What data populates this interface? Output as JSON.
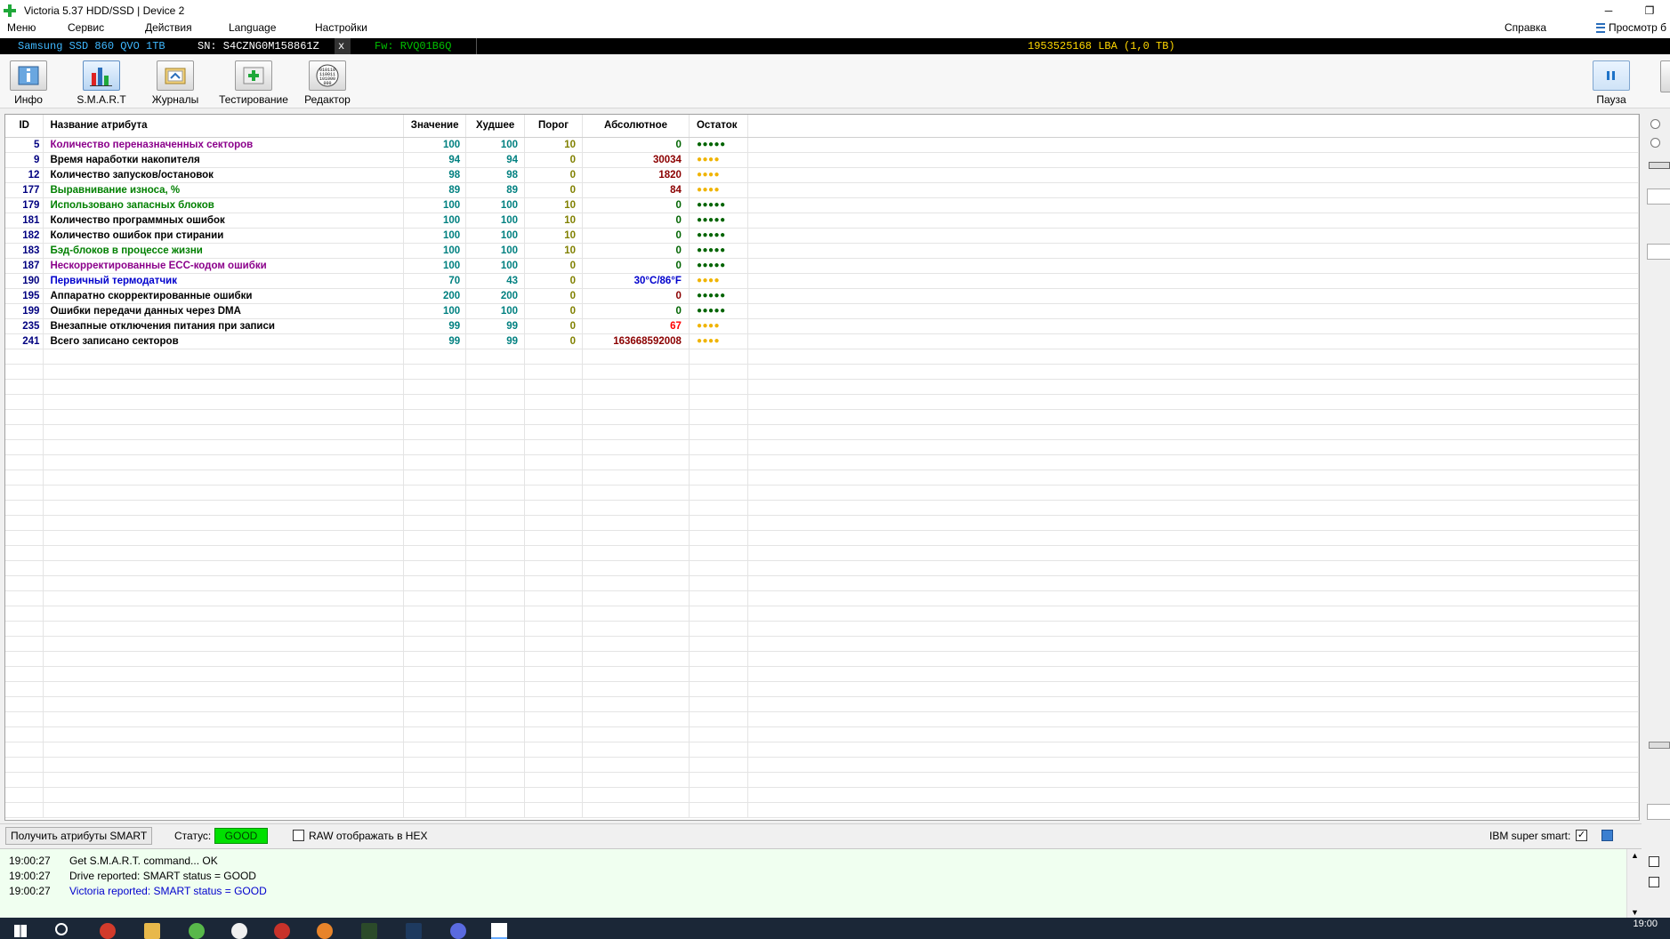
{
  "window": {
    "title": "Victoria 5.37 HDD/SSD | Device 2",
    "minimize_glyph": "─",
    "restore_glyph": "❐"
  },
  "menu": {
    "items": [
      "Меню",
      "Сервис",
      "Действия",
      "Language",
      "Настройки"
    ],
    "help": "Справка",
    "view": "Просмотр б"
  },
  "device": {
    "model": "Samsung SSD 860 QVO 1TB",
    "serial": "SN: S4CZNG0M158861Z",
    "close_glyph": "x",
    "firmware": "Fw: RVQ01B6Q",
    "capacity": "1953525168 LBA (1,0 TB)"
  },
  "toolbar": {
    "buttons": [
      {
        "label": "Инфо",
        "icon": "info-icon"
      },
      {
        "label": "S.M.A.R.T",
        "icon": "smart-chart-icon"
      },
      {
        "label": "Журналы",
        "icon": "logs-icon"
      },
      {
        "label": "Тестирование",
        "icon": "testing-icon"
      },
      {
        "label": "Редактор",
        "icon": "hex-editor-icon"
      }
    ],
    "pause_label": "Пауза"
  },
  "smart_table": {
    "headers": {
      "id": "ID",
      "name": "Название атрибута",
      "value": "Значение",
      "worst": "Худшее",
      "threshold": "Порог",
      "raw": "Абсолютное",
      "remaining": "Остаток"
    },
    "rows": [
      {
        "id": "5",
        "name": "Количество переназначенных секторов",
        "value": "100",
        "worst": "100",
        "threshold": "10",
        "raw": "0",
        "remaining": "●●●●●",
        "name_color": "#8b008b",
        "raw_color": "#006400",
        "rem_color": "#006400"
      },
      {
        "id": "9",
        "name": "Время наработки накопителя",
        "value": "94",
        "worst": "94",
        "threshold": "0",
        "raw": "30034",
        "remaining": "●●●●",
        "name_color": "#000000",
        "raw_color": "#8b0000",
        "rem_color": "#f0b400"
      },
      {
        "id": "12",
        "name": "Количество запусков/остановок",
        "value": "98",
        "worst": "98",
        "threshold": "0",
        "raw": "1820",
        "remaining": "●●●●",
        "name_color": "#000000",
        "raw_color": "#8b0000",
        "rem_color": "#f0b400"
      },
      {
        "id": "177",
        "name": "Выравнивание износа, %",
        "value": "89",
        "worst": "89",
        "threshold": "0",
        "raw": "84",
        "remaining": "●●●●",
        "name_color": "#008000",
        "raw_color": "#8b0000",
        "rem_color": "#f0b400"
      },
      {
        "id": "179",
        "name": "Использовано запасных блоков",
        "value": "100",
        "worst": "100",
        "threshold": "10",
        "raw": "0",
        "remaining": "●●●●●",
        "name_color": "#008000",
        "raw_color": "#006400",
        "rem_color": "#006400"
      },
      {
        "id": "181",
        "name": "Количество программных ошибок",
        "value": "100",
        "worst": "100",
        "threshold": "10",
        "raw": "0",
        "remaining": "●●●●●",
        "name_color": "#000000",
        "raw_color": "#006400",
        "rem_color": "#006400"
      },
      {
        "id": "182",
        "name": "Количество ошибок при стирании",
        "value": "100",
        "worst": "100",
        "threshold": "10",
        "raw": "0",
        "remaining": "●●●●●",
        "name_color": "#000000",
        "raw_color": "#006400",
        "rem_color": "#006400"
      },
      {
        "id": "183",
        "name": "Бэд-блоков в процессе жизни",
        "value": "100",
        "worst": "100",
        "threshold": "10",
        "raw": "0",
        "remaining": "●●●●●",
        "name_color": "#008000",
        "raw_color": "#006400",
        "rem_color": "#006400"
      },
      {
        "id": "187",
        "name": "Нескорректированные ECC-кодом ошибки",
        "value": "100",
        "worst": "100",
        "threshold": "0",
        "raw": "0",
        "remaining": "●●●●●",
        "name_color": "#8b008b",
        "raw_color": "#006400",
        "rem_color": "#006400"
      },
      {
        "id": "190",
        "name": "Первичный термодатчик",
        "value": "70",
        "worst": "43",
        "threshold": "0",
        "raw": "30°C/86°F",
        "remaining": "●●●●",
        "name_color": "#0000cd",
        "raw_color": "#0000cd",
        "rem_color": "#f0b400"
      },
      {
        "id": "195",
        "name": "Аппаратно скорректированные ошибки",
        "value": "200",
        "worst": "200",
        "threshold": "0",
        "raw": "0",
        "remaining": "●●●●●",
        "name_color": "#000000",
        "raw_color": "#8b0000",
        "rem_color": "#006400"
      },
      {
        "id": "199",
        "name": "Ошибки передачи данных через DMA",
        "value": "100",
        "worst": "100",
        "threshold": "0",
        "raw": "0",
        "remaining": "●●●●●",
        "name_color": "#000000",
        "raw_color": "#006400",
        "rem_color": "#006400"
      },
      {
        "id": "235",
        "name": "Внезапные отключения питания при записи",
        "value": "99",
        "worst": "99",
        "threshold": "0",
        "raw": "67",
        "remaining": "●●●●",
        "name_color": "#000000",
        "raw_color": "#ff0000",
        "rem_color": "#f0b400"
      },
      {
        "id": "241",
        "name": "Всего записано секторов",
        "value": "99",
        "worst": "99",
        "threshold": "0",
        "raw": "163668592008",
        "remaining": "●●●●",
        "name_color": "#000000",
        "raw_color": "#8b0000",
        "rem_color": "#f0b400"
      }
    ]
  },
  "statusbar": {
    "get_smart_label": "Получить атрибуты SMART",
    "status_label": "Статус:",
    "status_value": "GOOD",
    "raw_hex_label": "RAW отображать в HEX",
    "raw_hex_checked": false,
    "ibm_label": "IBM super smart:",
    "ibm_checked": true
  },
  "log": [
    {
      "time": "19:00:27",
      "message": "Get S.M.A.R.T. command... OK",
      "color": "#000000"
    },
    {
      "time": "19:00:27",
      "message": "Drive reported: SMART status = GOOD",
      "color": "#000000"
    },
    {
      "time": "19:00:27",
      "message": "Victoria reported: SMART status = GOOD",
      "color": "#0000cd"
    }
  ],
  "taskbar": {
    "clock": "19:00"
  },
  "colors": {
    "device_model": "#3fb8ff",
    "device_serial": "#ffffff",
    "device_fw": "#00c000",
    "device_capacity": "#ffd700",
    "id_col": "#000080",
    "value_col": "#008080",
    "threshold_col": "#808000"
  }
}
